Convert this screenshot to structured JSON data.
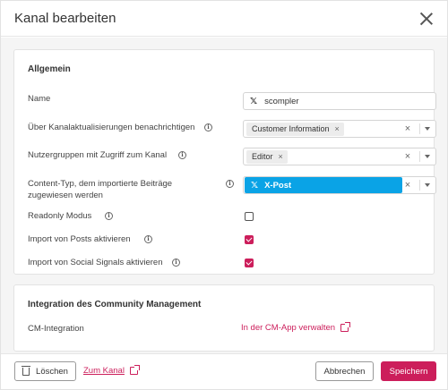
{
  "dialog": {
    "title": "Kanal bearbeiten"
  },
  "general": {
    "heading": "Allgemein",
    "name_label": "Name",
    "name_value": "scompler",
    "notify_label": "Über Kanalaktualisierungen benachrichtigen",
    "notify_tag": "Customer Information",
    "groups_label": "Nutzergruppen mit Zugriff zum Kanal",
    "groups_tag": "Editor",
    "content_type_label_line1": "Content-Typ, dem importierte Beiträge",
    "content_type_label_line2": "zugewiesen werden",
    "content_type_value": "X-Post",
    "readonly_label": "Readonly Modus",
    "readonly_checked": false,
    "import_posts_label": "Import von Posts aktivieren",
    "import_posts_checked": true,
    "import_signals_label": "Import von Social Signals aktivieren",
    "import_signals_checked": true
  },
  "community": {
    "heading": "Integration des Community Management",
    "cm_label": "CM-Integration",
    "cm_link": "In der CM-App verwalten"
  },
  "footer": {
    "delete_label": "Löschen",
    "to_channel_label": "Zum Kanal",
    "cancel_label": "Abbrechen",
    "save_label": "Speichern"
  },
  "icons": {
    "x_logo": "𝕏",
    "info": "i",
    "remove": "×",
    "clear": "×"
  },
  "colors": {
    "accent": "#cc1e5b",
    "content_type_bg": "#0aa3e6"
  }
}
